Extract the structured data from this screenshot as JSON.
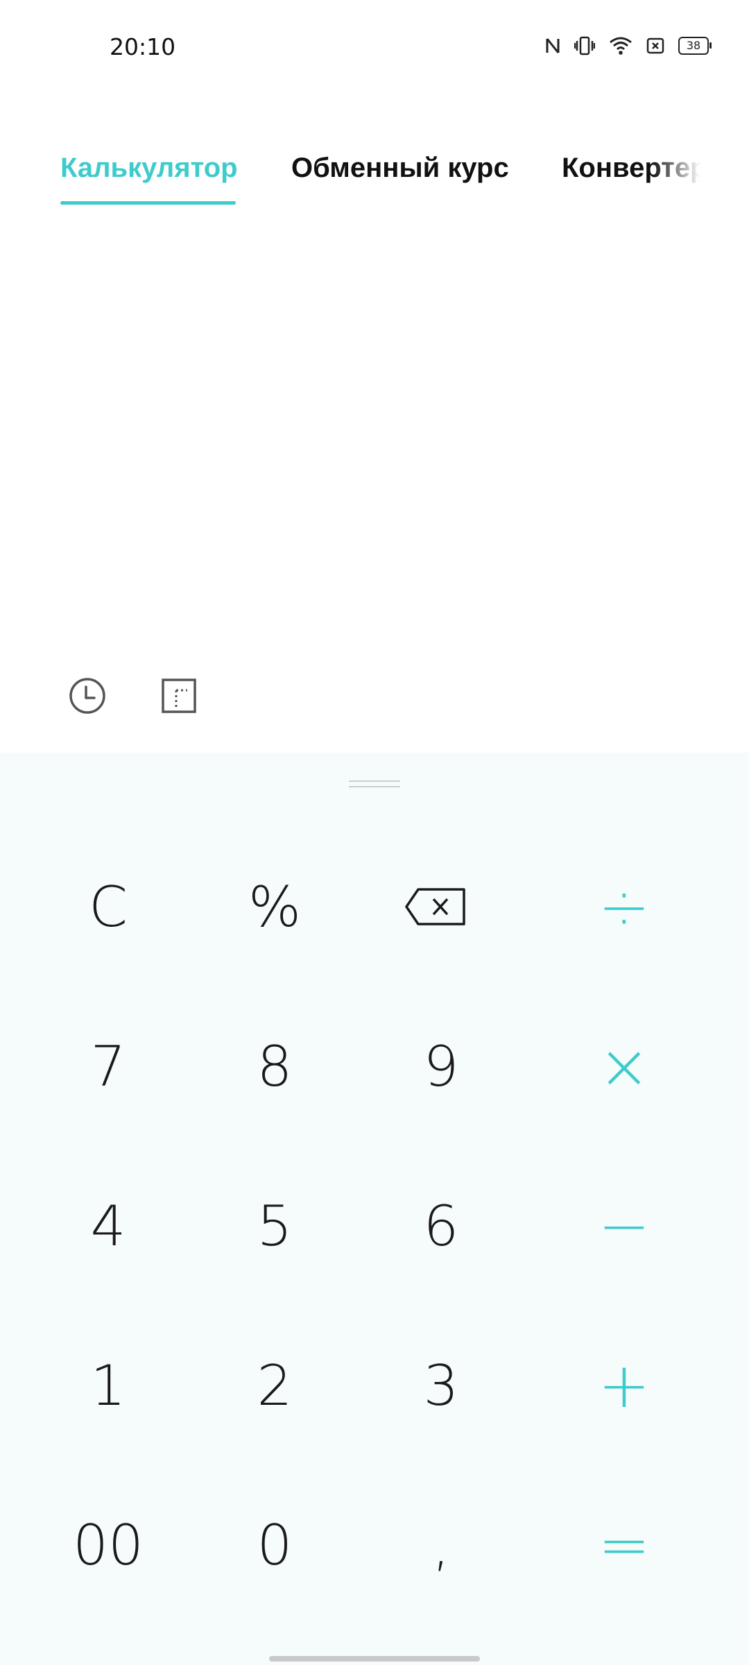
{
  "status_bar": {
    "time": "20:10",
    "battery_level": "38",
    "icons": [
      "nfc-icon",
      "vibrate-icon",
      "wifi-icon",
      "sim-off-icon",
      "battery-icon"
    ]
  },
  "tabs": [
    {
      "label": "Калькулятор",
      "active": true
    },
    {
      "label": "Обменный курс",
      "active": false
    },
    {
      "label": "Конвертер",
      "active": false
    }
  ],
  "tools": {
    "history_icon": "history-icon",
    "scientific_icon": "scientific-mode-icon"
  },
  "keypad": {
    "rows": [
      [
        "C",
        "%",
        "⌫",
        "÷"
      ],
      [
        "7",
        "8",
        "9",
        "×"
      ],
      [
        "4",
        "5",
        "6",
        "−"
      ],
      [
        "1",
        "2",
        "3",
        "+"
      ],
      [
        "00",
        "0",
        ",",
        "="
      ]
    ]
  },
  "colors": {
    "accent": "#3ecbcc",
    "keypad_background": "#f6fbfc",
    "text": "#111111"
  }
}
